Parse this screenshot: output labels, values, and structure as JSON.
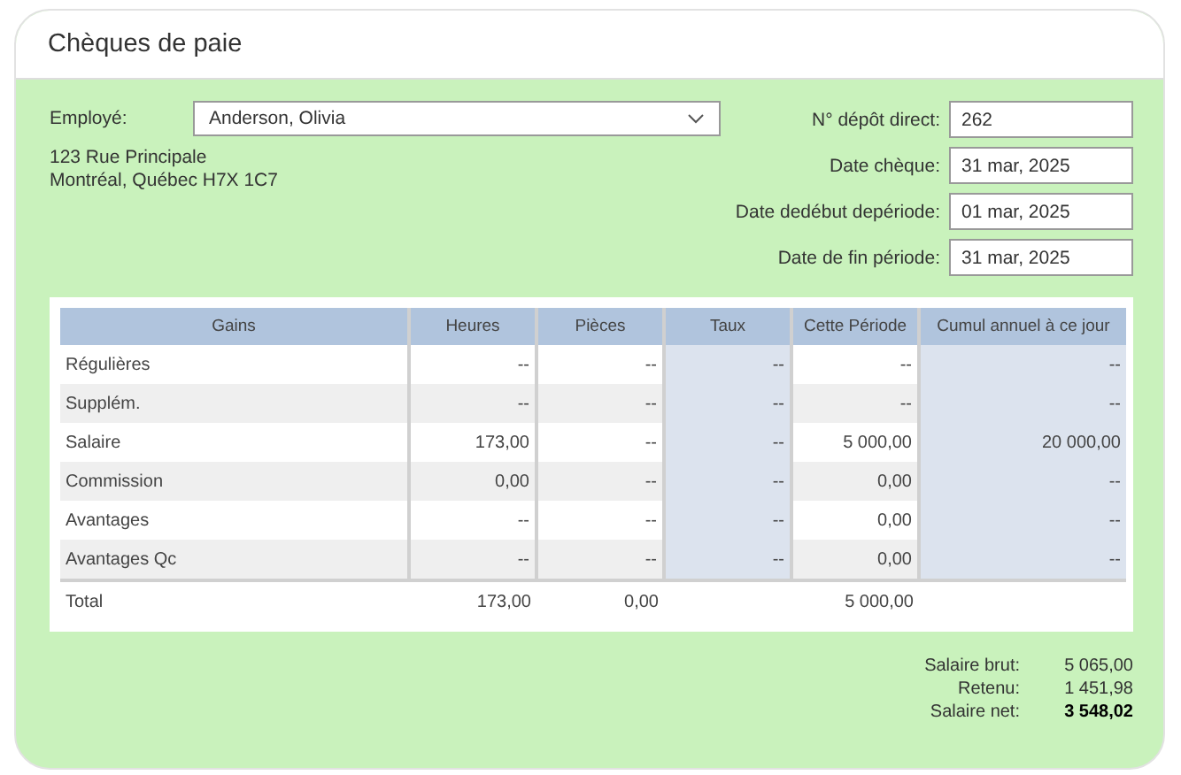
{
  "title": "Chèques de paie",
  "employee": {
    "label": "Employé:",
    "value": "Anderson, Olivia"
  },
  "address": [
    "123 Rue Principale",
    "Montréal, Québec H7X 1C7"
  ],
  "fields": [
    {
      "label": "N° dépôt direct:",
      "value": "262"
    },
    {
      "label": "Date chèque:",
      "value": "31 mar, 2025"
    },
    {
      "label": "Date dedébut depériode:",
      "value": "01 mar, 2025"
    },
    {
      "label": "Date de fin période:",
      "value": "31 mar, 2025"
    }
  ],
  "table": {
    "columns": [
      {
        "label": "Gains",
        "shaded": false
      },
      {
        "label": "Heures",
        "shaded": false
      },
      {
        "label": "Pièces",
        "shaded": false
      },
      {
        "label": "Taux",
        "shaded": true
      },
      {
        "label": "Cette Période",
        "shaded": false
      },
      {
        "label": "Cumul annuel à ce jour",
        "shaded": true
      }
    ],
    "rows": [
      [
        "Régulières",
        "--",
        "--",
        "--",
        "--",
        "--"
      ],
      [
        "Supplém.",
        "--",
        "--",
        "--",
        "--",
        "--"
      ],
      [
        "Salaire",
        "173,00",
        "--",
        "--",
        "5 000,00",
        "20 000,00"
      ],
      [
        "Commission",
        "0,00",
        "--",
        "--",
        "0,00",
        "--"
      ],
      [
        "Avantages",
        "--",
        "--",
        "--",
        "0,00",
        "--"
      ],
      [
        "Avantages Qc",
        "--",
        "--",
        "--",
        "0,00",
        "--"
      ]
    ],
    "total": {
      "label": "Total",
      "heures": "173,00",
      "pieces": "0,00",
      "periode": "5 000,00"
    }
  },
  "summary": [
    {
      "label": "Salaire brut:",
      "value": "5 065,00",
      "bold": false
    },
    {
      "label": "Retenu:",
      "value": "1 451,98",
      "bold": false
    },
    {
      "label": "Salaire net:",
      "value": "3 548,02",
      "bold": true
    }
  ]
}
